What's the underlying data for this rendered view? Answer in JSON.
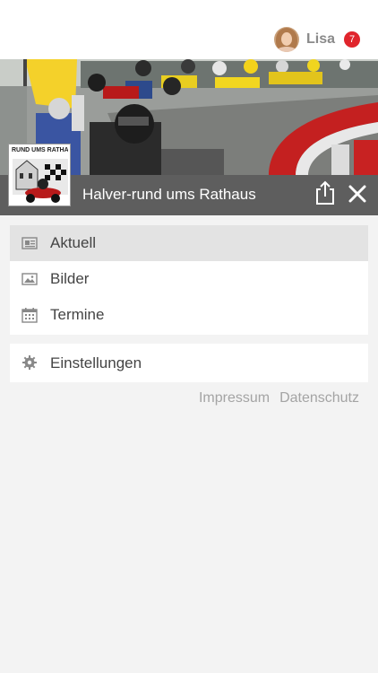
{
  "header": {
    "username": "Lisa",
    "notification_count": "7",
    "avatar_icon": "user-avatar"
  },
  "club": {
    "title": "Halver-rund ums Rathaus",
    "logo_text": "RUND UMS RATHAUS",
    "share_icon": "share-icon",
    "close_icon": "close-icon"
  },
  "menu": {
    "items": [
      {
        "label": "Aktuell",
        "icon": "newspaper-icon",
        "active": true
      },
      {
        "label": "Bilder",
        "icon": "image-icon",
        "active": false
      },
      {
        "label": "Termine",
        "icon": "calendar-icon",
        "active": false
      }
    ],
    "settings": {
      "label": "Einstellungen",
      "icon": "gear-icon"
    }
  },
  "footer": {
    "impressum": "Impressum",
    "datenschutz": "Datenschutz"
  },
  "colors": {
    "badge": "#e0252c",
    "caption_bar": "#5e5e5e",
    "active_item": "#e3e3e3",
    "background": "#f3f3f3"
  }
}
